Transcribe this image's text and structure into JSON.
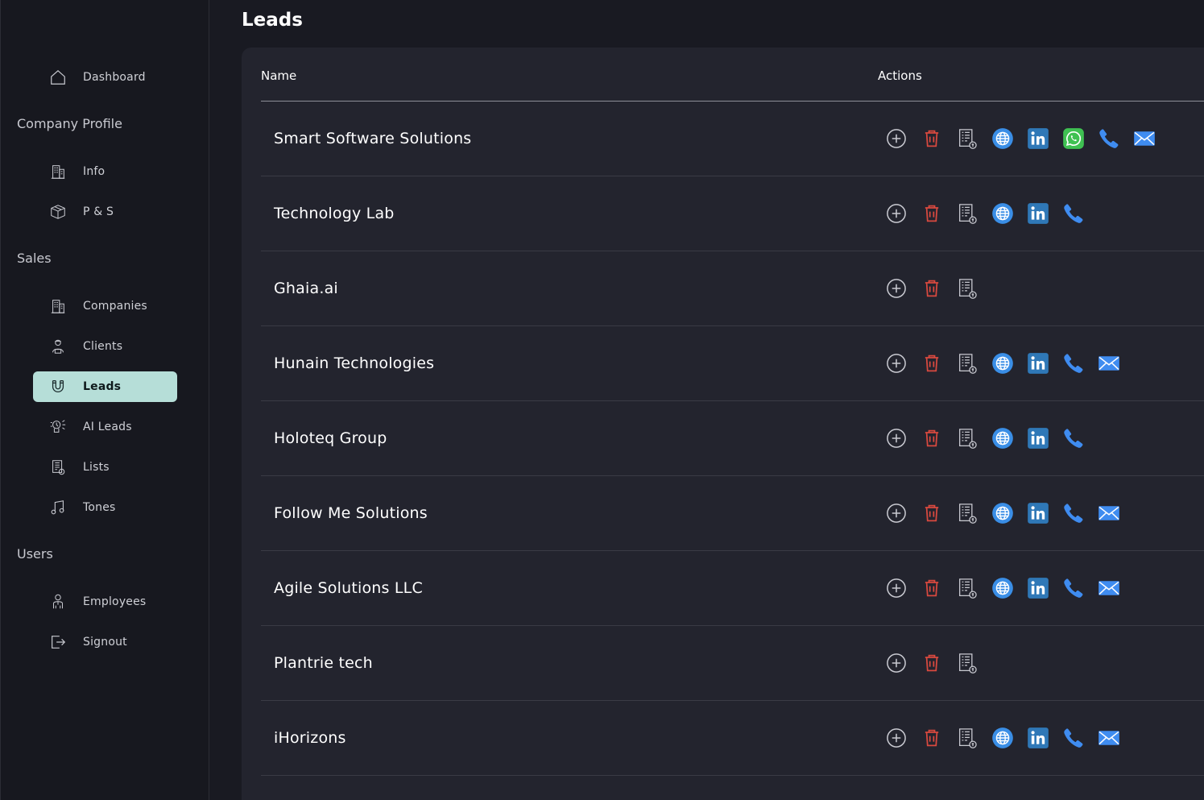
{
  "page": {
    "title": "Leads"
  },
  "sidebar": {
    "items": [
      {
        "label": "Dashboard",
        "icon": "home-icon"
      },
      {
        "label": "Info",
        "icon": "building-icon"
      },
      {
        "label": "P & S",
        "icon": "box-icon"
      },
      {
        "label": "Companies",
        "icon": "building-icon"
      },
      {
        "label": "Clients",
        "icon": "client-icon"
      },
      {
        "label": "Leads",
        "icon": "magnet-icon",
        "active": true
      },
      {
        "label": "AI Leads",
        "icon": "ai-brain-icon"
      },
      {
        "label": "Lists",
        "icon": "list-document-icon"
      },
      {
        "label": "Tones",
        "icon": "music-note-icon"
      },
      {
        "label": "Employees",
        "icon": "employee-icon"
      },
      {
        "label": "Signout",
        "icon": "signout-icon"
      }
    ],
    "sections": [
      "Company Profile",
      "Sales",
      "Users"
    ]
  },
  "table": {
    "columns": [
      "Name",
      "Actions"
    ],
    "rows": [
      {
        "name": "Smart Software Solutions",
        "actions": [
          "add",
          "delete",
          "list",
          "website",
          "linkedin",
          "whatsapp",
          "phone",
          "email"
        ]
      },
      {
        "name": "Technology Lab",
        "actions": [
          "add",
          "delete",
          "list",
          "website",
          "linkedin",
          "phone"
        ]
      },
      {
        "name": "Ghaia.ai",
        "actions": [
          "add",
          "delete",
          "list"
        ]
      },
      {
        "name": "Hunain Technologies",
        "actions": [
          "add",
          "delete",
          "list",
          "website",
          "linkedin",
          "phone",
          "email"
        ]
      },
      {
        "name": "Holoteq Group",
        "actions": [
          "add",
          "delete",
          "list",
          "website",
          "linkedin",
          "phone"
        ]
      },
      {
        "name": "Follow Me Solutions",
        "actions": [
          "add",
          "delete",
          "list",
          "website",
          "linkedin",
          "phone",
          "email"
        ]
      },
      {
        "name": "Agile Solutions LLC",
        "actions": [
          "add",
          "delete",
          "list",
          "website",
          "linkedin",
          "phone",
          "email"
        ]
      },
      {
        "name": "Plantrie tech",
        "actions": [
          "add",
          "delete",
          "list"
        ]
      },
      {
        "name": "iHorizons",
        "actions": [
          "add",
          "delete",
          "list",
          "website",
          "linkedin",
          "phone",
          "email"
        ]
      }
    ]
  },
  "colors": {
    "accent": "#b6ded8",
    "delete": "#d9493f",
    "website": "#3a8ee6",
    "linkedin": "#2f78b7",
    "whatsapp": "#3fc152",
    "phone": "#3f8cf0",
    "email": "#3f8cf0"
  }
}
